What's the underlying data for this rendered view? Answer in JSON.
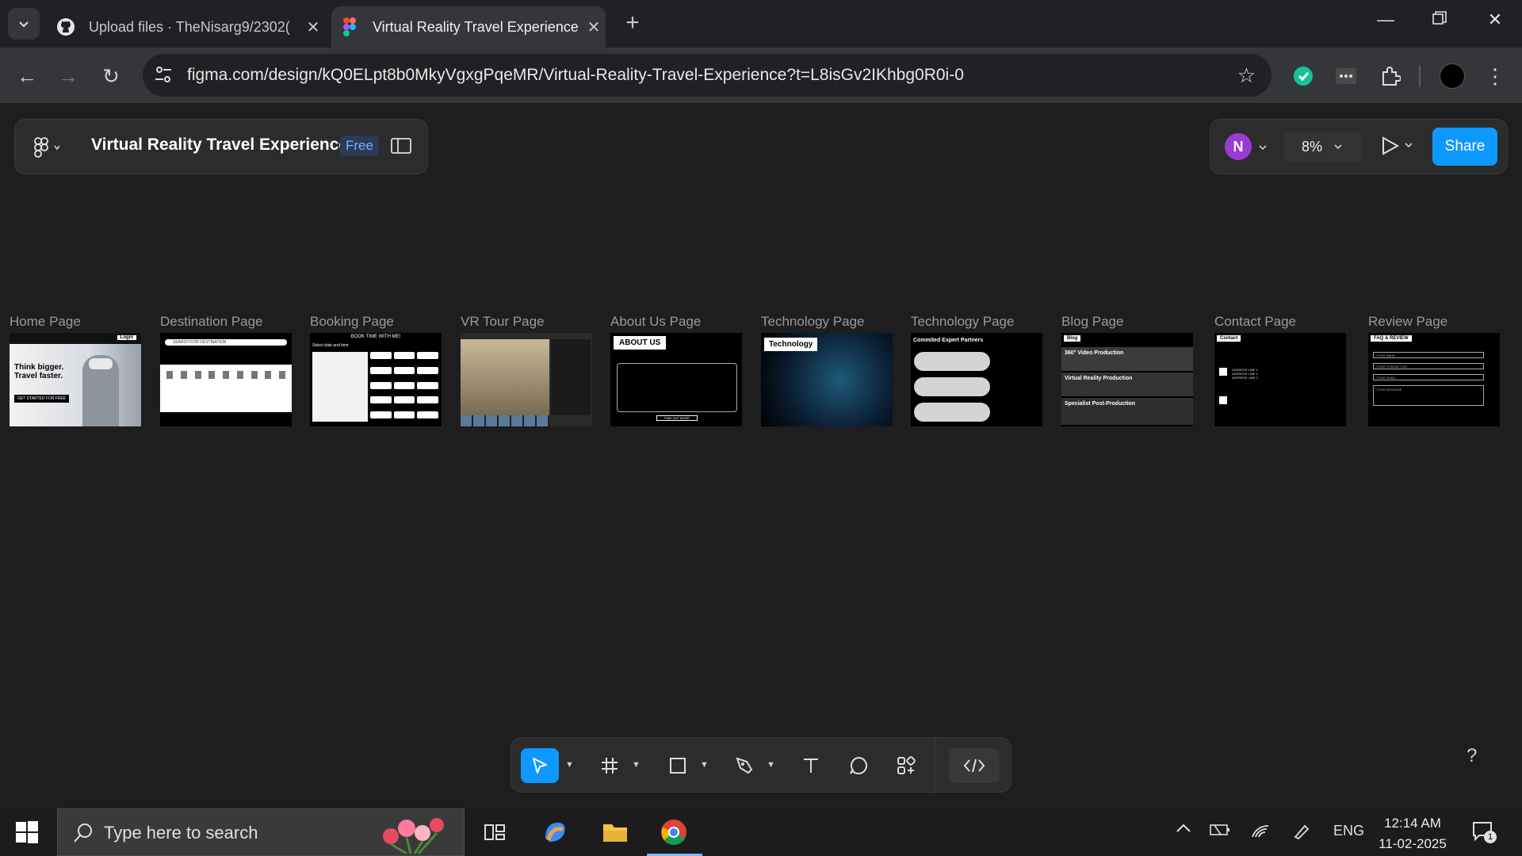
{
  "browser": {
    "tabs": [
      {
        "title": "Upload files · TheNisarg9/2302(",
        "active": false,
        "icon": "github-icon"
      },
      {
        "title": "Virtual Reality Travel Experience",
        "active": true,
        "icon": "figma-icon"
      }
    ],
    "url": "figma.com/design/kQ0ELpt8b0MkyVgxgPqeMR/Virtual-Reality-Travel-Experience?t=L8isGv2IKhbg0R0i-0"
  },
  "figma": {
    "file_name": "Virtual Reality Travel Experience",
    "plan_badge": "Free",
    "avatar_initial": "N",
    "zoom": "8%",
    "share_label": "Share",
    "accent": "#0d99ff",
    "frames": [
      {
        "label": "Home Page",
        "thumb_text": [
          "Think bigger.",
          "Travel faster.",
          "Login",
          "GET STARTED FOR FREE"
        ]
      },
      {
        "label": "Destination Page",
        "thumb_text": [
          "SEARCH FOR DESTINATION"
        ]
      },
      {
        "label": "Booking Page",
        "thumb_text": [
          "BOOK TIME WITH ME!",
          "Select date and time"
        ]
      },
      {
        "label": "VR Tour Page",
        "thumb_text": []
      },
      {
        "label": "About Us Page",
        "thumb_text": [
          "ABOUT US",
          "FIND OUT MORE"
        ]
      },
      {
        "label": "Technology Page",
        "thumb_text": [
          "Technology"
        ]
      },
      {
        "label": "Technology Page",
        "thumb_text": [
          "Commited Expert Partners"
        ]
      },
      {
        "label": "Blog Page",
        "thumb_text": [
          "Blog",
          "360° Video Production",
          "Virtual Reality Production",
          "Specialist Post-Production"
        ]
      },
      {
        "label": "Contact Page",
        "thumb_text": [
          "Contact",
          "ADDRESS LINE 1",
          "ADDRESS LINE 2",
          "ADDRESS LINE 3"
        ]
      },
      {
        "label": "Review Page",
        "thumb_text": [
          "FAQ & REVIEW",
          "YOUR NAME",
          "YOUR CONTACT NO.",
          "YOUR EMAIL",
          "YOUR MESSAGE"
        ]
      }
    ]
  },
  "taskbar": {
    "search_placeholder": "Type here to search",
    "lang": "ENG",
    "time": "12:14 AM",
    "date": "11-02-2025",
    "notification_count": "1"
  }
}
